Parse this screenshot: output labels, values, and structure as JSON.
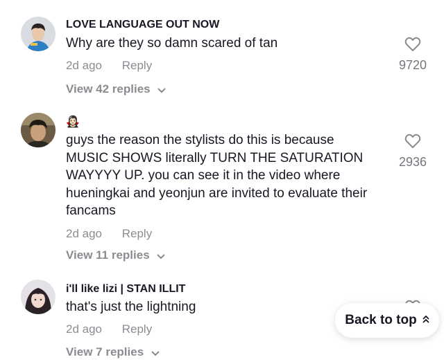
{
  "comments": [
    {
      "username": "LOVE LANGUAGE OUT NOW",
      "text": "Why are they so damn scared of tan",
      "time": "2d ago",
      "reply_label": "Reply",
      "likes": "9720",
      "view_replies": "View 42 replies"
    },
    {
      "username": "🧛🏻‍♀️",
      "text": "guys the reason the stylists do this is because MUSIC SHOWS literally TURN THE SATURATION WAYYYY UP. you can see it in the video where hueningkai and yeonjun are invited to evaluate their fancams",
      "time": "2d ago",
      "reply_label": "Reply",
      "likes": "2936",
      "view_replies": "View 11 replies"
    },
    {
      "username": "i'll like lizi | STAN ILLIT",
      "text": "that's just the lightning",
      "time": "2d ago",
      "reply_label": "Reply",
      "view_replies": "View 7 replies"
    }
  ],
  "back_to_top": {
    "label": "Back to top"
  },
  "icons": {
    "like": "heart-outline-icon",
    "expand": "chevron-down-icon",
    "back_to_top": "double-chevron-up-icon"
  }
}
